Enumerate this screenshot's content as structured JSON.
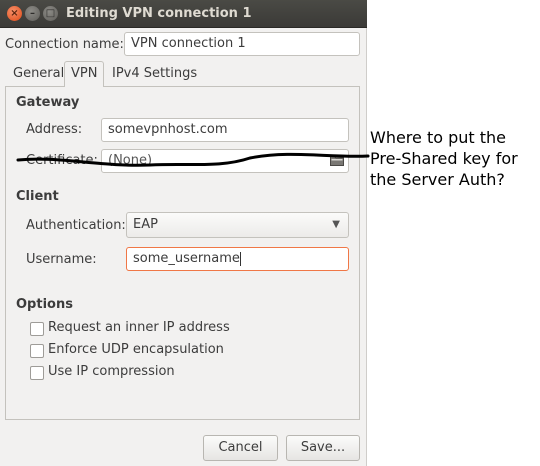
{
  "window": {
    "title": "Editing VPN connection 1",
    "controls": {
      "close": "×",
      "minimize": "–",
      "maximize": "□"
    }
  },
  "connection_name": {
    "label": "Connection name:",
    "value": "VPN connection 1"
  },
  "tabs": [
    {
      "label": "General",
      "selected": false
    },
    {
      "label": "VPN",
      "selected": true
    },
    {
      "label": "IPv4 Settings",
      "selected": false
    }
  ],
  "gateway": {
    "heading": "Gateway",
    "address_label": "Address:",
    "address_value": "somevpnhost.com",
    "certificate_label": "Certificate:",
    "certificate_value": "(None)"
  },
  "client": {
    "heading": "Client",
    "auth_label": "Authentication:",
    "auth_value": "EAP",
    "username_label": "Username:",
    "username_value": "some_username"
  },
  "options": {
    "heading": "Options",
    "items": [
      {
        "label": "Request an inner IP address",
        "checked": false
      },
      {
        "label": "Enforce UDP encapsulation",
        "checked": false
      },
      {
        "label": "Use IP compression",
        "checked": false
      }
    ]
  },
  "buttons": {
    "cancel": "Cancel",
    "save": "Save..."
  },
  "annotation": {
    "text": "Where to put the Pre-Shared key for the Server Auth?",
    "color": "#000000"
  },
  "colors": {
    "focus_border": "#f07746",
    "titlebar": "#3c3b37",
    "close_button": "#e9541f"
  },
  "icons": {
    "folder": "folder-icon",
    "dropdown": "chevron-down-icon"
  }
}
